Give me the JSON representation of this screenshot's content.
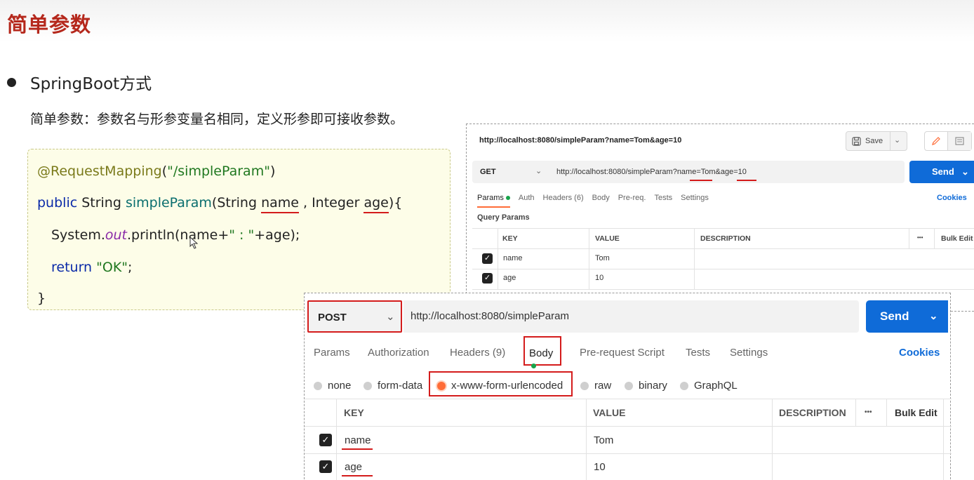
{
  "slide": {
    "title": "简单参数",
    "bullet": "SpringBoot方式",
    "description": "简单参数：参数名与形参变量名相同，定义形参即可接收参数。"
  },
  "code": {
    "line1_annotation": "@RequestMapping",
    "line1_open": "(",
    "line1_string": "\"/simpleParam\"",
    "line1_close": ")",
    "line2_kw": "public",
    "line2_type": " String ",
    "line2_fn": "simpleParam",
    "line2_open": "(String ",
    "line2_name": "name",
    "line2_mid": " , Integer ",
    "line2_age": "age",
    "line2_close": "){",
    "line3_a": "System.",
    "line3_out": "out",
    "line3_b": ".println(name+",
    "line3_str": "\" : \"",
    "line3_c": "+age);",
    "line4_kw": "return",
    "line4_str": " \"OK\"",
    "line4_end": ";",
    "line5": "}"
  },
  "get_request": {
    "header_url": "http://localhost:8080/simpleParam?name=Tom&age=10",
    "save_label": "Save",
    "method": "GET",
    "url": "http://localhost:8080/simpleParam?name=Tom&age=10",
    "send_label": "Send",
    "tabs": [
      "Params",
      "Auth",
      "Headers (6)",
      "Body",
      "Pre-req.",
      "Tests",
      "Settings"
    ],
    "cookies_label": "Cookies",
    "query_params_label": "Query Params",
    "columns": [
      "KEY",
      "VALUE",
      "DESCRIPTION"
    ],
    "more_label": "•••",
    "bulk_edit_label": "Bulk Edit",
    "rows": [
      {
        "key": "name",
        "value": "Tom"
      },
      {
        "key": "age",
        "value": "10"
      }
    ]
  },
  "post_request": {
    "method": "POST",
    "url": "http://localhost:8080/simpleParam",
    "send_label": "Send",
    "tabs": {
      "params": "Params",
      "authorization": "Authorization",
      "headers": "Headers (9)",
      "body": "Body",
      "prerequest": "Pre-request Script",
      "tests": "Tests",
      "settings": "Settings"
    },
    "cookies_label": "Cookies",
    "body_types": {
      "none": "none",
      "form_data": "form-data",
      "urlencoded": "x-www-form-urlencoded",
      "raw": "raw",
      "binary": "binary",
      "graphql": "GraphQL"
    },
    "selected_body_type": "x-www-form-urlencoded",
    "columns": [
      "KEY",
      "VALUE",
      "DESCRIPTION"
    ],
    "more_label": "•••",
    "bulk_edit_label": "Bulk Edit",
    "rows": [
      {
        "key": "name",
        "value": "Tom"
      },
      {
        "key": "age",
        "value": "10"
      }
    ]
  },
  "colors": {
    "title_red": "#b5281c",
    "send_blue": "#0f6bd8",
    "highlight_red": "#d41c1c",
    "active_orange": "#ff6c37",
    "dot_green": "#17a34a"
  },
  "icons": {
    "save": "floppy-disk-icon",
    "dropdown": "chevron-down-icon",
    "edit": "pencil-icon",
    "comment": "comment-icon",
    "checkbox": "check-icon"
  }
}
